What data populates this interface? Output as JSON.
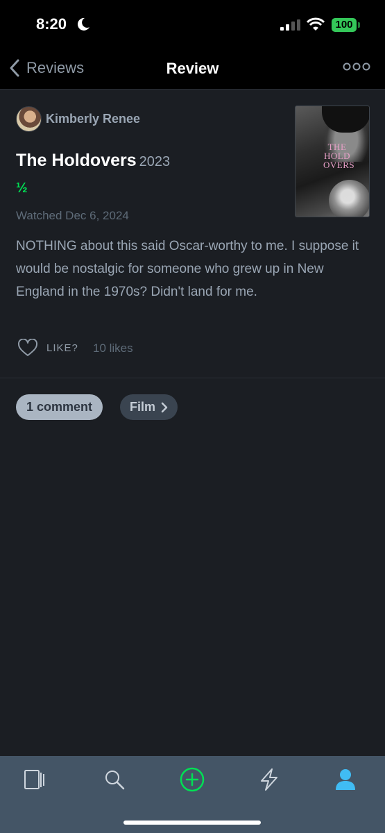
{
  "status_bar": {
    "time": "8:20",
    "battery": "100",
    "icons": [
      "moon-icon",
      "cellular-signal-icon",
      "wifi-icon",
      "battery-icon"
    ]
  },
  "nav": {
    "back_label": "Reviews",
    "title": "Review",
    "icons": [
      "chevron-left-icon",
      "more-dots-icon"
    ]
  },
  "review": {
    "author": "Kimberly Renee",
    "film_title": "The Holdovers",
    "film_year": "2023",
    "rating": "½",
    "rating_color": "#00e054",
    "watched": "Watched Dec 6, 2024",
    "body": "NOTHING about this said Oscar-worthy to me. I suppose it would be nostalgic for someone who grew up in New England in the 1970s? Didn't land for me.",
    "poster_title": "THE HOLD OVERS",
    "like_label": "LIKE?",
    "like_count": "10 likes"
  },
  "pills": {
    "comments": "1 comment",
    "film": "Film"
  },
  "tab_bar": {
    "icons": [
      "films-icon",
      "search-icon",
      "add-icon",
      "activity-icon",
      "profile-icon"
    ],
    "accent_add": "#00e054",
    "accent_active": "#40bcf4"
  },
  "colors": {
    "background": "#1b1e23",
    "tab_bar": "#445566"
  }
}
